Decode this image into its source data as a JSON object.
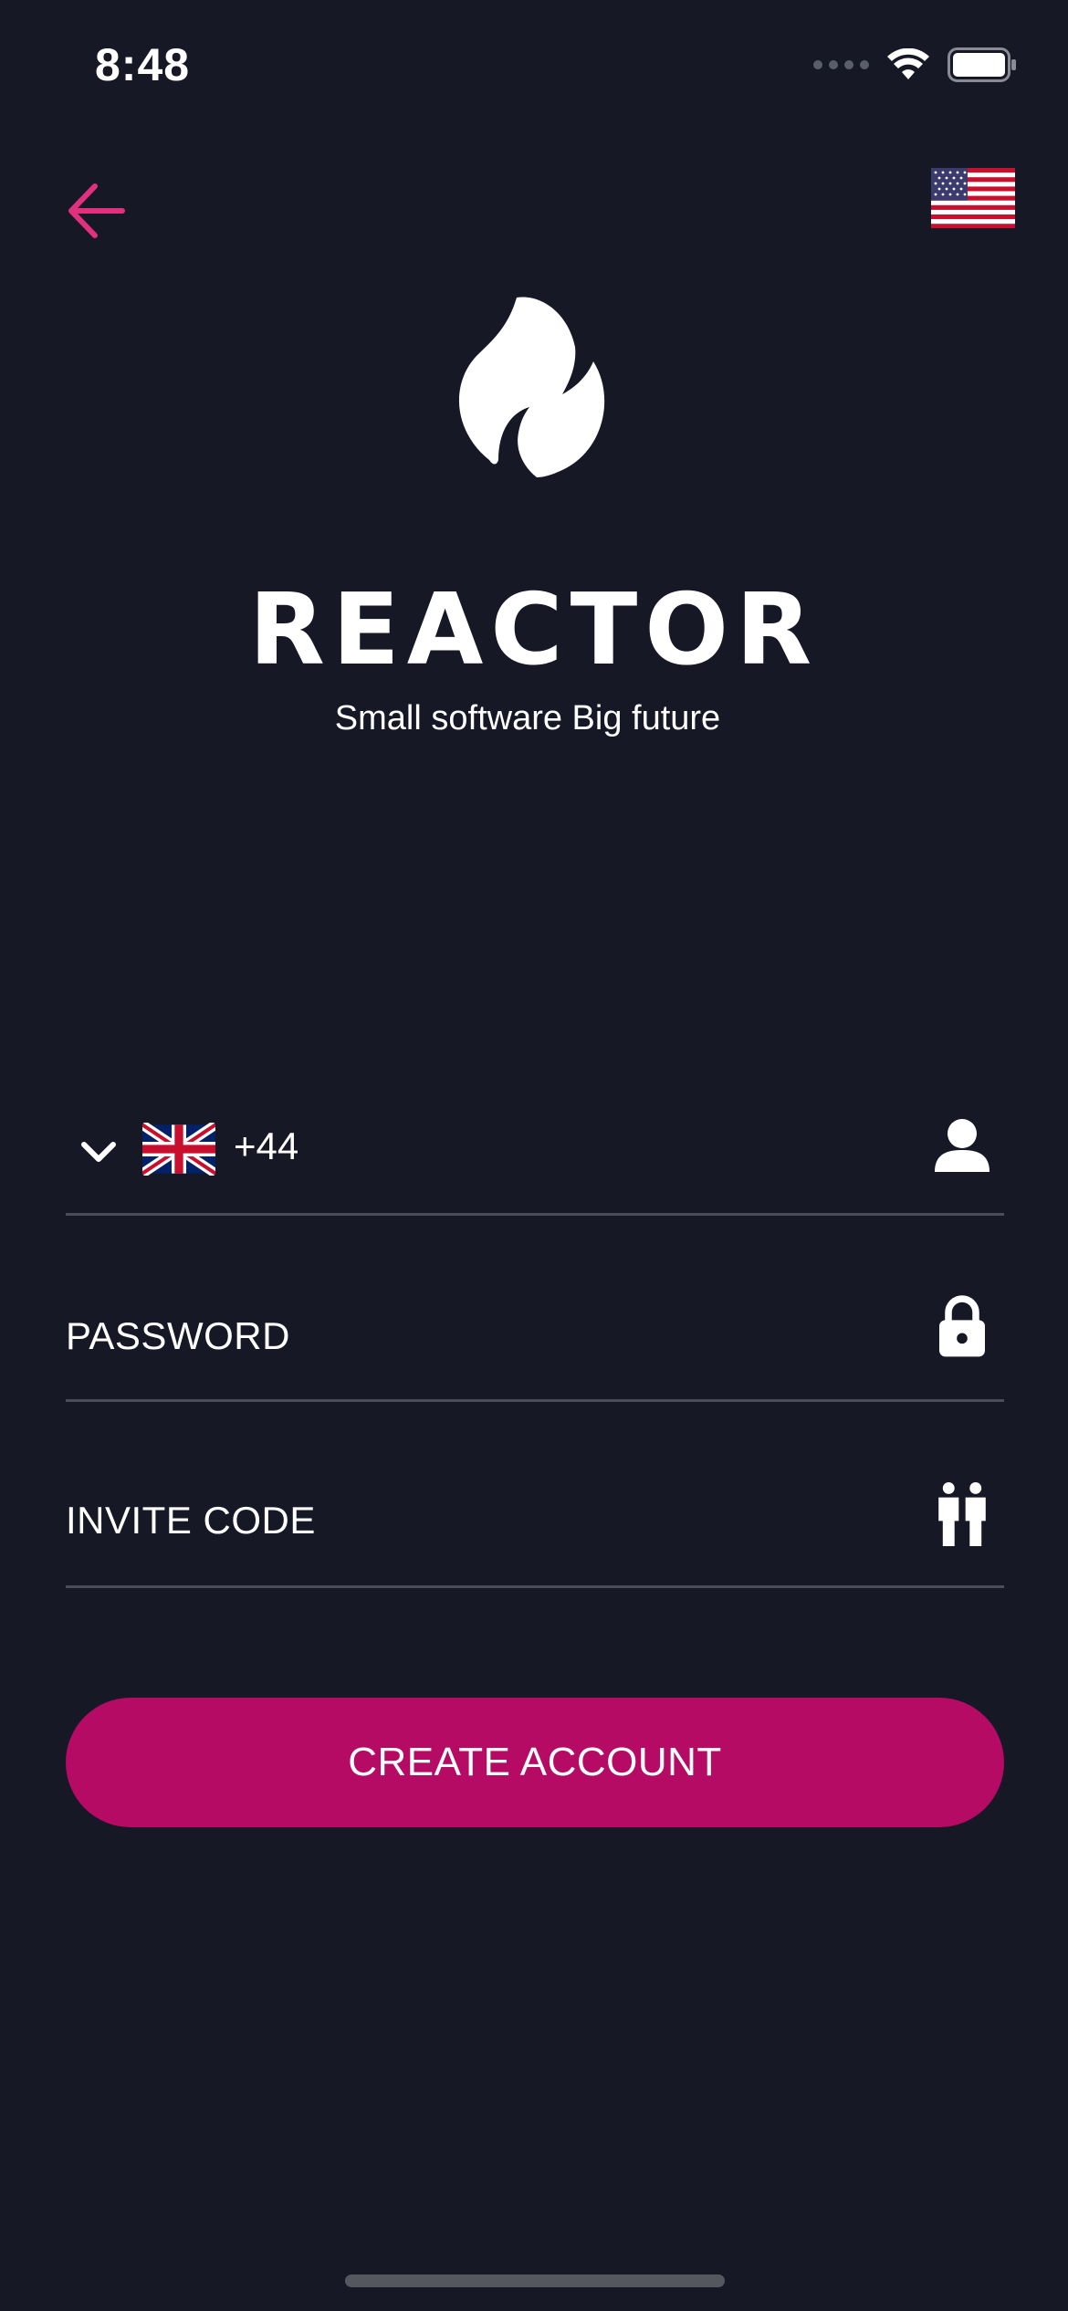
{
  "status_bar": {
    "time": "8:48"
  },
  "header": {
    "back_icon": "arrow-left-icon",
    "language_flag": "us-flag-icon"
  },
  "brand": {
    "logo_icon": "flame-icon",
    "name": "REACTOR",
    "tagline": "Small software Big future"
  },
  "form": {
    "phone": {
      "country_flag": "uk-flag-icon",
      "dial_code": "+44",
      "value": "",
      "icon": "user-icon"
    },
    "password": {
      "placeholder": "PASSWORD",
      "value": "",
      "icon": "lock-icon"
    },
    "invite_code": {
      "placeholder": "INVITE CODE",
      "value": "",
      "icon": "people-icon"
    }
  },
  "actions": {
    "create_account_label": "CREATE ACCOUNT"
  },
  "colors": {
    "background": "#161825",
    "accent": "#b50b65",
    "back_arrow": "#e0307e",
    "divider": "#4a4c58"
  }
}
